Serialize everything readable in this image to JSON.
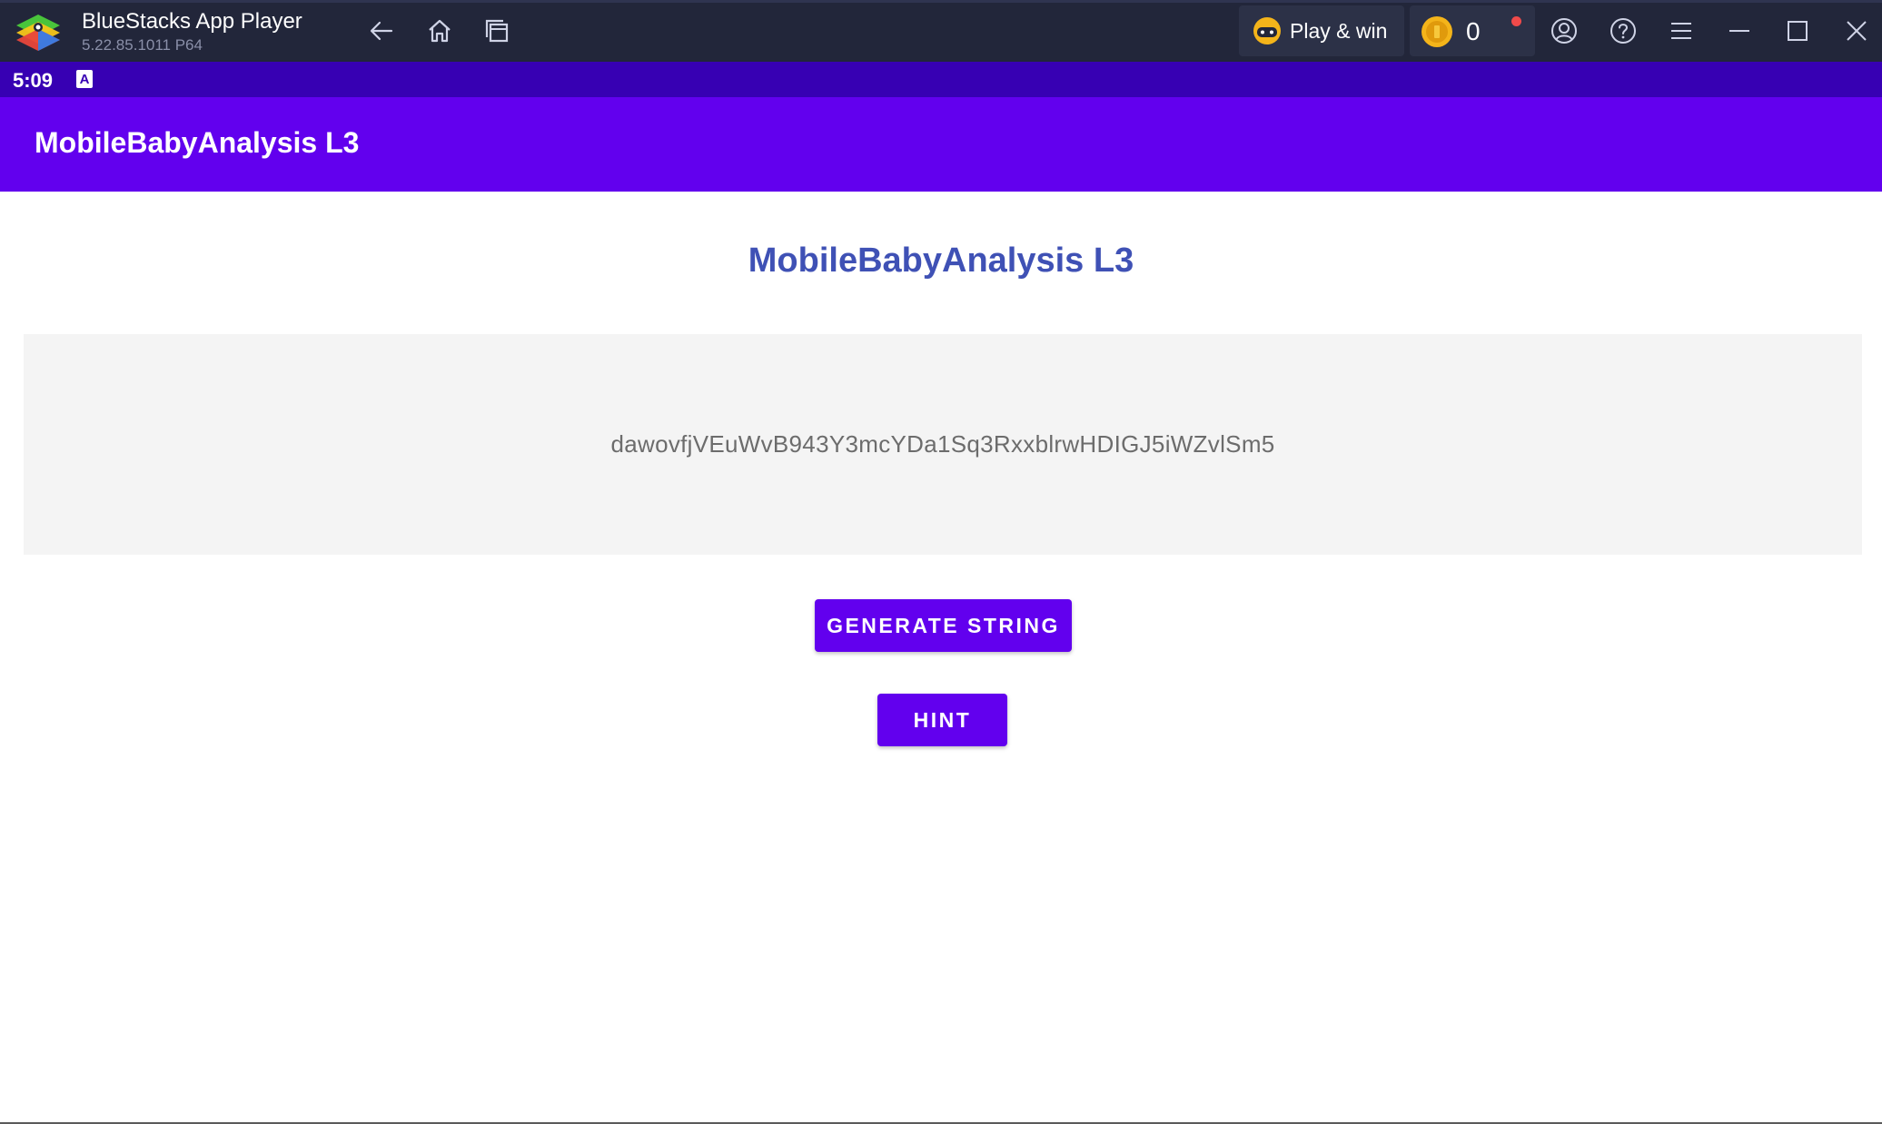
{
  "window": {
    "app_name": "BlueStacks App Player",
    "version": "5.22.85.1011  P64",
    "play_win_label": "Play & win",
    "coin_count": "0",
    "nav_icons": [
      "back-arrow-icon",
      "home-icon",
      "recent-apps-icon"
    ],
    "window_icons": [
      "account-icon",
      "help-icon",
      "menu-icon",
      "minimize-icon",
      "maximize-icon",
      "close-icon"
    ]
  },
  "status_bar": {
    "time": "5:09",
    "notification_glyph": "A"
  },
  "app_bar": {
    "title": "MobileBabyAnalysis L3"
  },
  "main": {
    "heading": "MobileBabyAnalysis L3",
    "generated_string": "dawovfjVEuWvB943Y3mcYDa1Sq3RxxblrwHDIGJ5iWZvlSm5",
    "generate_button": "GENERATE STRING",
    "hint_button": "HINT"
  },
  "colors": {
    "title_bar": "#22263a",
    "status_bar": "#3700b3",
    "primary": "#6200ee",
    "heading": "#3f51b5",
    "string_box": "#f4f4f4"
  }
}
